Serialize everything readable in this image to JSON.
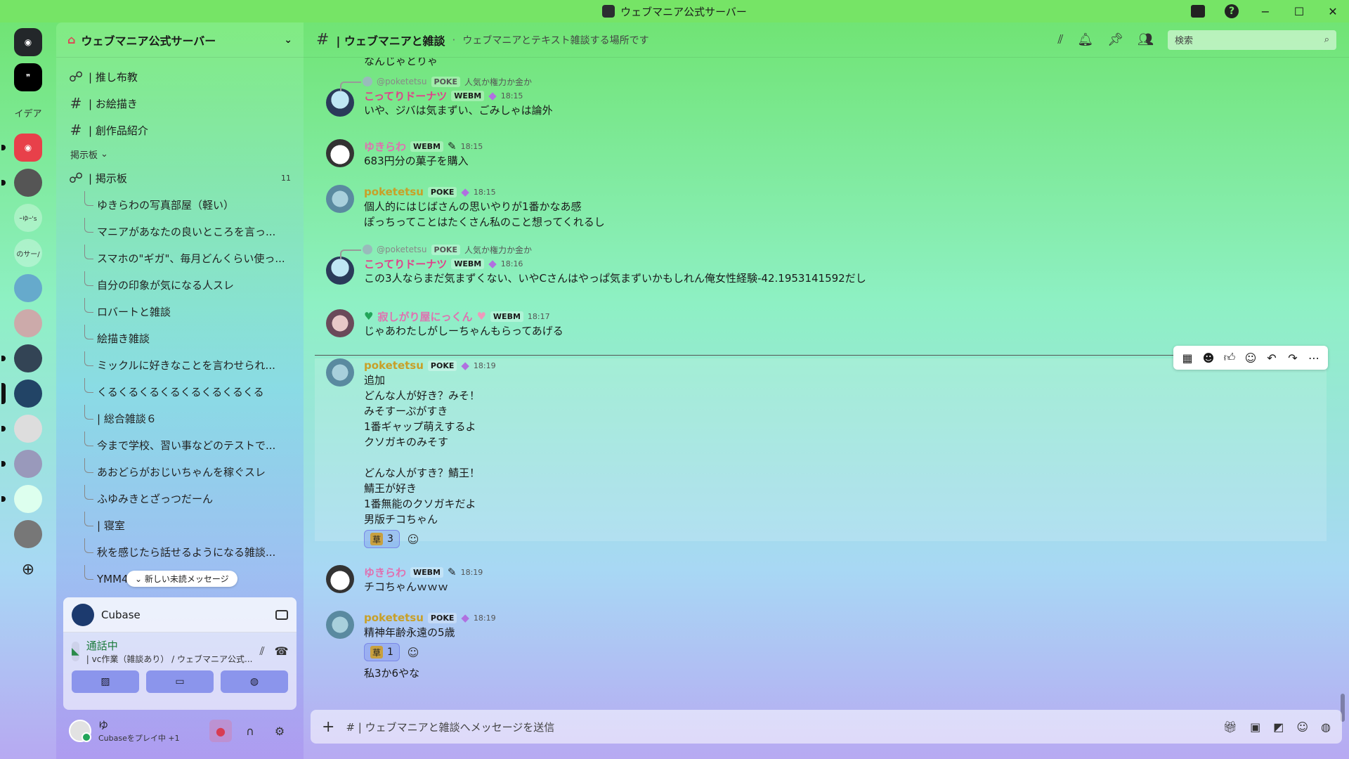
{
  "window": {
    "title": "ウェブマニア公式サーバー"
  },
  "rail": {
    "items": [
      "",
      "イデア",
      "",
      "",
      "ｰゆｰ's",
      "のサー/",
      "",
      "",
      "",
      "",
      "",
      "",
      "",
      "",
      ""
    ]
  },
  "sidebar": {
    "guild_name": "ウェブマニア公式サーバー",
    "channels": [
      {
        "label": "| 推し布教",
        "icon": "forum"
      },
      {
        "label": "| お絵描き",
        "icon": "hash"
      },
      {
        "label": "| 創作品紹介",
        "icon": "hash"
      }
    ],
    "category": "掲示板",
    "forum": {
      "label": "| 掲示板",
      "badge": "11"
    },
    "threads": [
      "ゆきらわの写真部屋（軽い）",
      "マニアがあなたの良いところを言っ...",
      "スマホの\"ギガ\"、毎月どんくらい使っ...",
      "自分の印象が気になる人スレ",
      "ロバートと雑談",
      "絵描き雑談",
      "ミックルに好きなことを言わせられ...",
      "くるくるくるくるくるくるくるくる",
      "| 総合雑談６",
      "今まで学校、習い事などのテストで...",
      "あおどらがおじいちゃんを稼ぐスレ",
      "ふゆみきとざっつだーん",
      "| 寝室",
      "秋を感じたら話せるようになる雑談...",
      "YMM4雑談"
    ],
    "new_unread": "新しい未読メッセージ"
  },
  "voice": {
    "app_name": "Cubase",
    "status": "通話中",
    "channel": "| vc作業（雑談あり） / ウェブマニア公式..."
  },
  "user": {
    "name": "ゆ",
    "activity": "Cubaseをプレイ中 +1"
  },
  "header": {
    "channel": "| ウェブマニアと雑談",
    "topic": "ウェブマニアとテキスト雑談する場所です",
    "search_placeholder": "検索"
  },
  "messages": [
    {
      "reply_to": "@poketetsu",
      "reply_tag": "POKE",
      "reply_text": "人気か権力か金か",
      "author": "こってりドーナツ",
      "tag": "WEBM",
      "time": "18:15",
      "text": "いや、ジバは気まずい、ごみしゃは論外",
      "color": "#e0418a",
      "avatar": "donut"
    },
    {
      "author": "ゆきらわ",
      "tag": "WEBM",
      "time": "18:15",
      "text": "683円分の菓子を購入",
      "color": "#e070b0",
      "avatar": "yuki"
    },
    {
      "author": "poketetsu",
      "tag": "POKE",
      "time": "18:15",
      "text": "個人的にはじばさんの思いやりが1番かなあ感\nぽっちってことはたくさん私のこと想ってくれるし",
      "color": "#c8a028",
      "avatar": "poke"
    },
    {
      "reply_to": "@poketetsu",
      "reply_tag": "POKE",
      "reply_text": "人気か権力か金か",
      "author": "こってりドーナツ",
      "tag": "WEBM",
      "time": "18:16",
      "text": "この3人ならまだ気まずくない、いやCさんはやっぱ気まずいかもしれん俺女性経験-42.1953141592だし",
      "color": "#e0418a",
      "avatar": "donut"
    },
    {
      "author": "寂しがり屋にっくん",
      "tag": "WEBM",
      "time": "18:17",
      "text": "じゃあわたしがしーちゃんもらってあげる",
      "color": "#e070b0",
      "avatar": "nikkun"
    },
    {
      "author": "poketetsu",
      "tag": "POKE",
      "time": "18:19",
      "text": "追加\nどんな人が好き？みそ！\nみそすーぷがすき\n1番ギャップ萌えするよ\nクソガキのみそす\n\nどんな人がすき？鯖王！\n鯖王が好き\n1番無能のクソガキだよ\n男版チコちゃん",
      "color": "#c8a028",
      "avatar": "poke",
      "reaction_count": "3"
    },
    {
      "author": "ゆきらわ",
      "tag": "WEBM",
      "time": "18:19",
      "text": "チコちゃんｗｗｗ",
      "color": "#e070b0",
      "avatar": "yuki"
    },
    {
      "author": "poketetsu",
      "tag": "POKE",
      "time": "18:19",
      "text": "精神年齢永遠の5歳",
      "color": "#c8a028",
      "avatar": "poke",
      "reaction_count": "1",
      "followup": "私3か6やな"
    }
  ],
  "top_partial_text": "なんじゃとりゃ",
  "composer": {
    "placeholder": "#  | ウェブマニアと雑談へメッセージを送信"
  },
  "icons": {
    "reaction_emoji": "草"
  }
}
